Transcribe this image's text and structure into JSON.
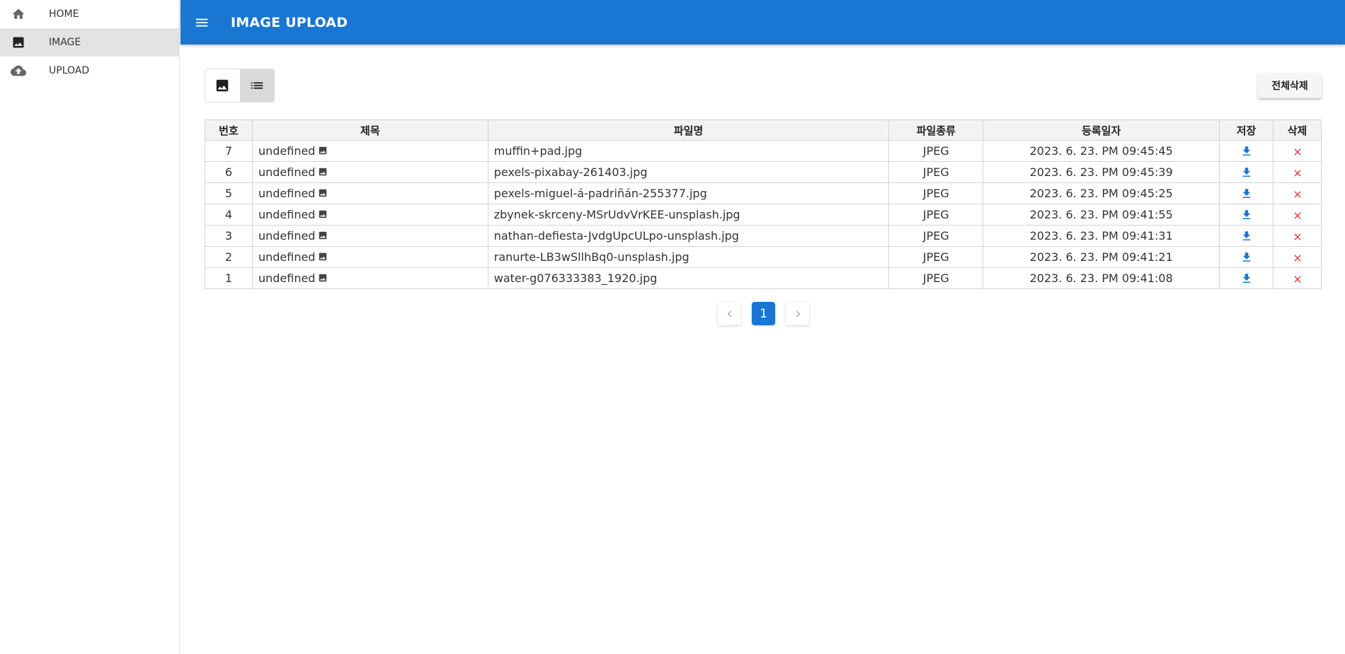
{
  "sidebar": {
    "items": [
      {
        "label": "HOME",
        "icon": "home-icon"
      },
      {
        "label": "IMAGE",
        "icon": "image-icon"
      },
      {
        "label": "UPLOAD",
        "icon": "cloud-upload-icon"
      }
    ]
  },
  "header": {
    "title": "IMAGE UPLOAD"
  },
  "toolbar": {
    "delete_all_label": "전체삭제",
    "view_modes": [
      "grid-view",
      "list-view"
    ],
    "selected_view": "list-view"
  },
  "table": {
    "headers": {
      "no": "번호",
      "title": "제목",
      "filename": "파일명",
      "filetype": "파일종류",
      "date": "등록일자",
      "save": "저장",
      "delete": "삭제"
    },
    "rows": [
      {
        "no": "7",
        "title": "undefined",
        "filename": "muffin+pad.jpg",
        "filetype": "JPEG",
        "date": "2023. 6. 23. PM 09:45:45"
      },
      {
        "no": "6",
        "title": "undefined",
        "filename": "pexels-pixabay-261403.jpg",
        "filetype": "JPEG",
        "date": "2023. 6. 23. PM 09:45:39"
      },
      {
        "no": "5",
        "title": "undefined",
        "filename": "pexels-miguel-á-padriñán-255377.jpg",
        "filetype": "JPEG",
        "date": "2023. 6. 23. PM 09:45:25"
      },
      {
        "no": "4",
        "title": "undefined",
        "filename": "zbynek-skrceny-MSrUdvVrKEE-unsplash.jpg",
        "filetype": "JPEG",
        "date": "2023. 6. 23. PM 09:41:55"
      },
      {
        "no": "3",
        "title": "undefined",
        "filename": "nathan-defiesta-JvdgUpcULpo-unsplash.jpg",
        "filetype": "JPEG",
        "date": "2023. 6. 23. PM 09:41:31"
      },
      {
        "no": "2",
        "title": "undefined",
        "filename": "ranurte-LB3wSllhBq0-unsplash.jpg",
        "filetype": "JPEG",
        "date": "2023. 6. 23. PM 09:41:21"
      },
      {
        "no": "1",
        "title": "undefined",
        "filename": "water-g076333383_1920.jpg",
        "filetype": "JPEG",
        "date": "2023. 6. 23. PM 09:41:08"
      }
    ]
  },
  "pagination": {
    "current": "1",
    "prev": "‹",
    "next": "›"
  },
  "colors": {
    "primary": "#1976d2",
    "download": "#1976d2",
    "delete": "#e53935"
  }
}
